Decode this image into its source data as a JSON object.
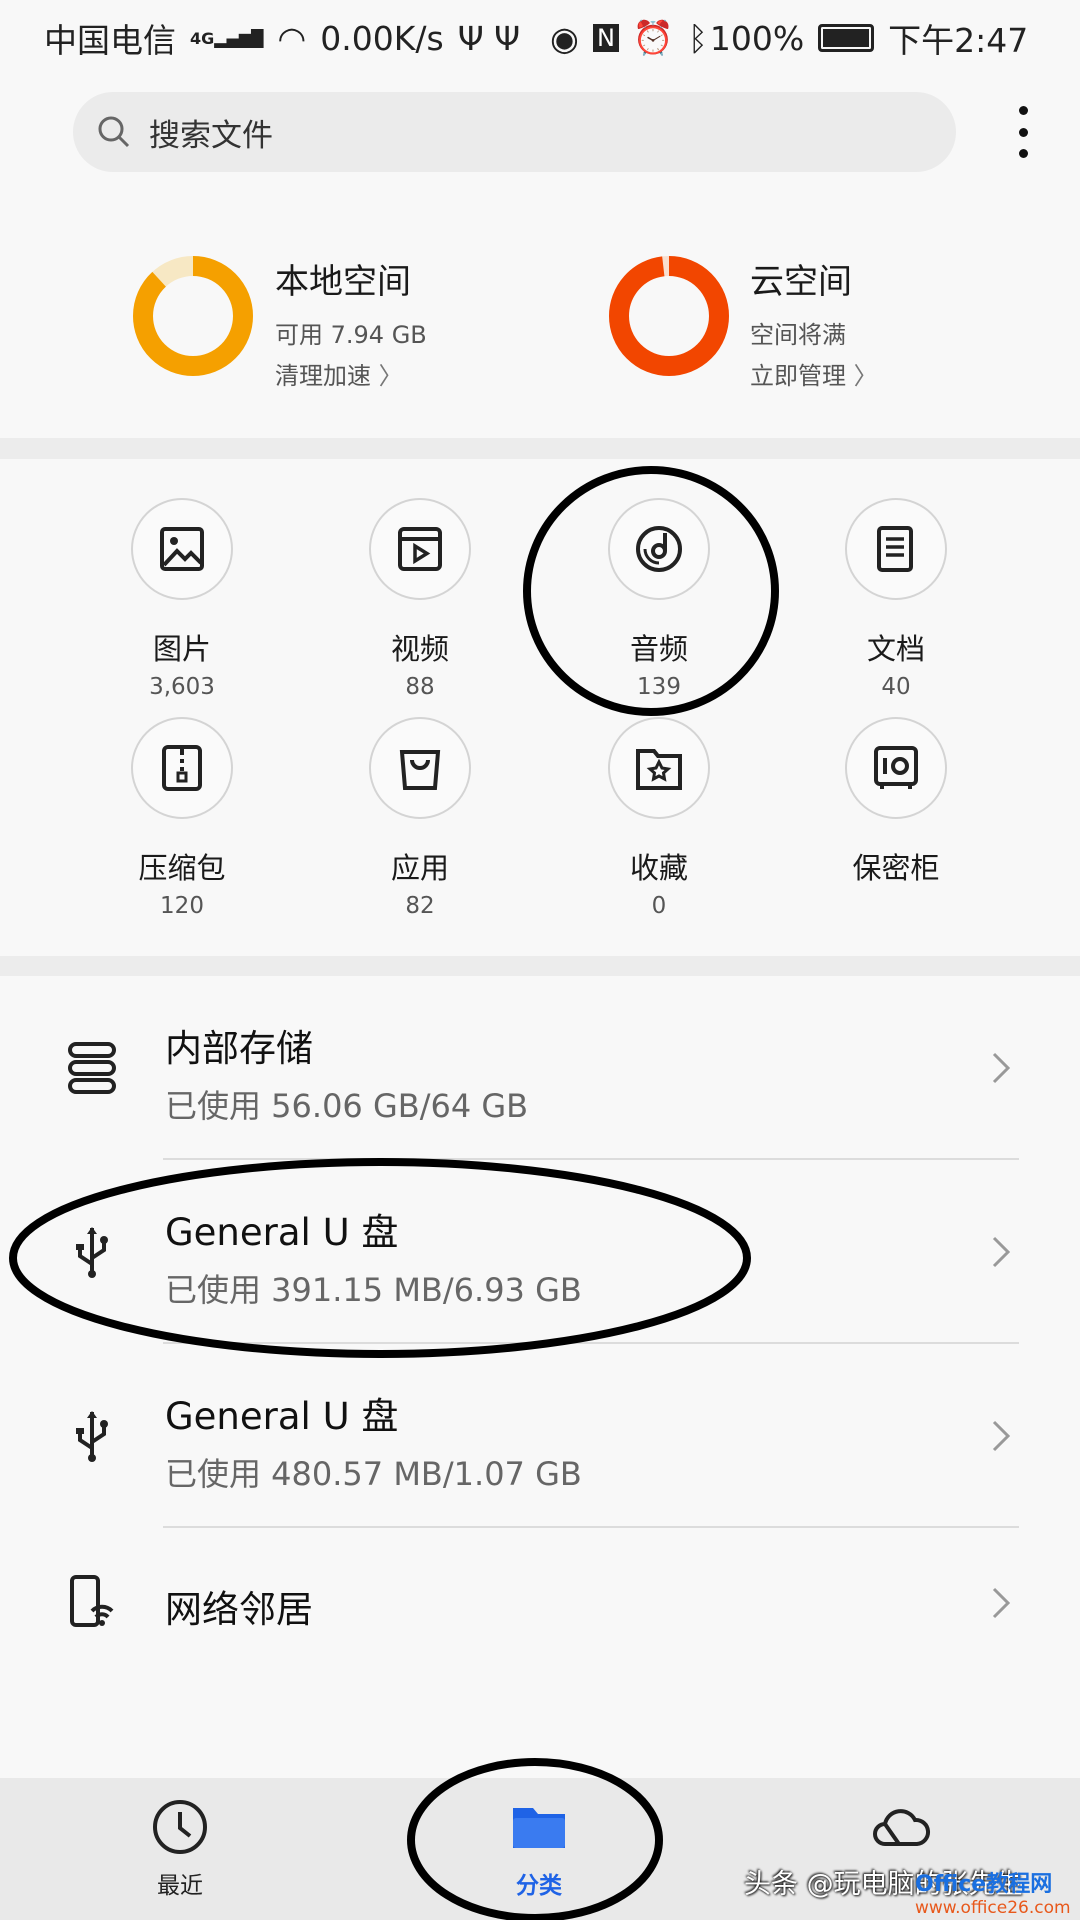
{
  "status_bar": {
    "carrier": "中国电信",
    "network": "4G",
    "speed": "0.00K/s",
    "battery": "100%",
    "time": "下午2:47"
  },
  "search": {
    "placeholder": "搜索文件"
  },
  "storage": [
    {
      "title": "本地空间",
      "sub": "可用 7.94 GB",
      "action": "清理加速",
      "used_fraction": 0.88,
      "color": "#f5a000",
      "track": "#f7e8c4"
    },
    {
      "title": "云空间",
      "sub": "空间将满",
      "action": "立即管理",
      "used_fraction": 0.98,
      "color": "#f24600",
      "track": "#f9dfcf"
    }
  ],
  "categories": [
    {
      "label": "图片",
      "count": "3,603",
      "icon": "image-icon"
    },
    {
      "label": "视频",
      "count": "88",
      "icon": "video-icon"
    },
    {
      "label": "音频",
      "count": "139",
      "icon": "music-disc-icon"
    },
    {
      "label": "文档",
      "count": "40",
      "icon": "document-icon"
    },
    {
      "label": "压缩包",
      "count": "120",
      "icon": "zip-icon"
    },
    {
      "label": "应用",
      "count": "82",
      "icon": "shopping-bag-icon"
    },
    {
      "label": "收藏",
      "count": "0",
      "icon": "star-folder-icon"
    },
    {
      "label": "保密柜",
      "count": "",
      "icon": "safe-icon"
    }
  ],
  "locations": [
    {
      "title": "内部存储",
      "sub": "已使用 56.06 GB/64 GB",
      "icon": "storage-icon"
    },
    {
      "title": "General U 盘",
      "sub": "已使用 391.15 MB/6.93 GB",
      "icon": "usb-icon"
    },
    {
      "title": "General U 盘",
      "sub": "已使用 480.57 MB/1.07 GB",
      "icon": "usb-icon"
    },
    {
      "title": "网络邻居",
      "sub": "",
      "icon": "network-phone-icon"
    }
  ],
  "nav": [
    {
      "label": "最近",
      "icon": "clock-icon"
    },
    {
      "label": "分类",
      "icon": "folder-icon",
      "active": true
    },
    {
      "label": "",
      "icon": "cloud-icon"
    }
  ],
  "accent": "#1f63e6",
  "watermark": "头条 @玩电脑的张先生",
  "logo": {
    "name": "Office教程网",
    "url": "www.office26.com"
  }
}
